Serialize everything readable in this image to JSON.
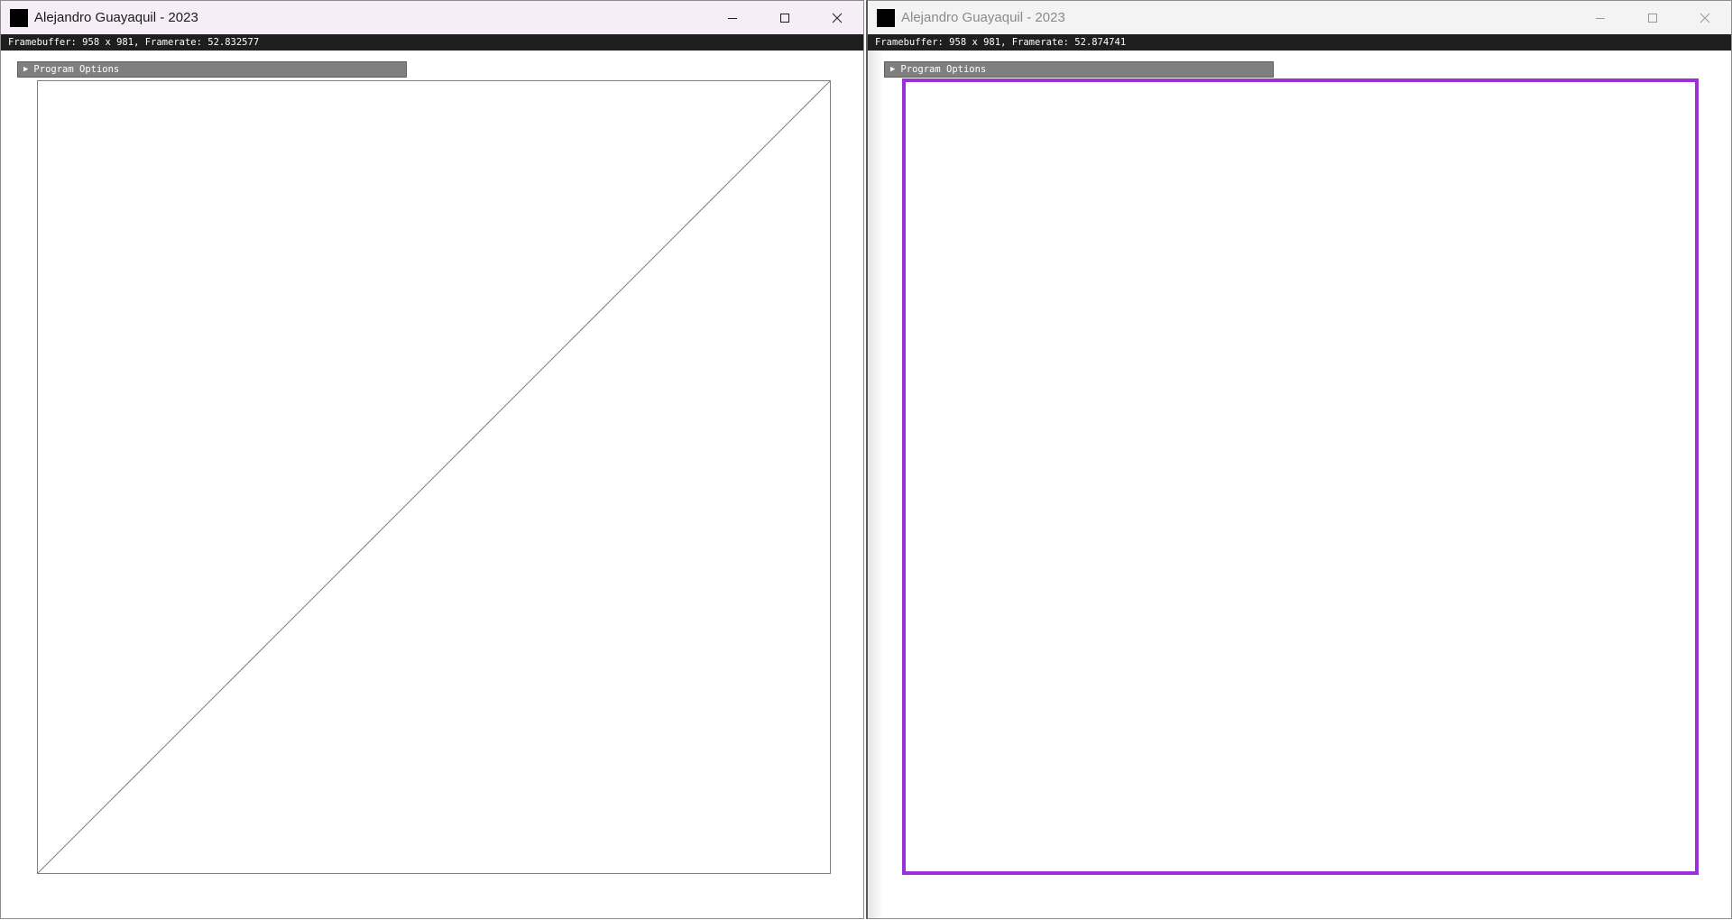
{
  "windows": [
    {
      "title": "Alejandro Guayaquil - 2023",
      "info": "Framebuffer: 958 x 981, Framerate: 52.832577",
      "options_label": "Program Options",
      "active": true,
      "scene": {
        "shape": "square-with-diagonal",
        "stroke_color": "#808080"
      }
    },
    {
      "title": "Alejandro Guayaquil - 2023",
      "info": "Framebuffer: 958 x 981, Framerate: 52.874741",
      "options_label": "Program Options",
      "active": false,
      "scene": {
        "shape": "square",
        "stroke_color": "#9b30d9"
      }
    }
  ],
  "icons": {
    "minimize": "minimize-icon",
    "maximize": "maximize-icon",
    "close": "close-icon",
    "app": "app-icon",
    "expand": "triangle-right-icon"
  }
}
